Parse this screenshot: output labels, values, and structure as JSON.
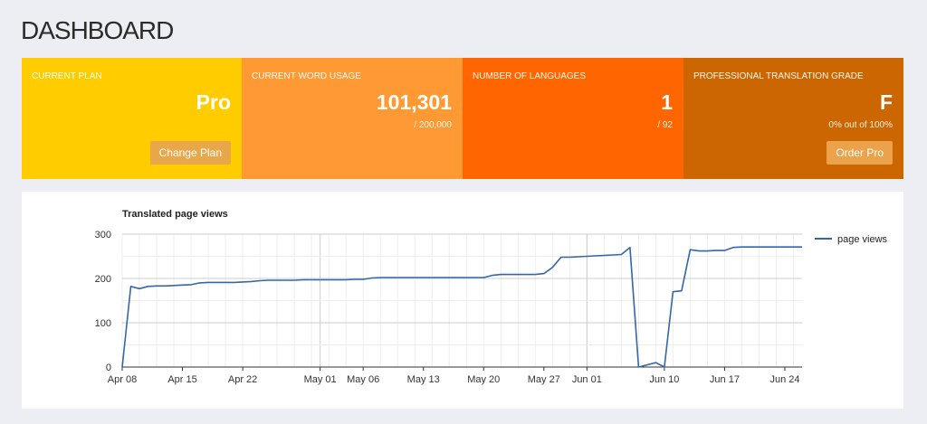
{
  "header": {
    "title": "DASHBOARD"
  },
  "cards": [
    {
      "label": "CURRENT PLAN",
      "value": "Pro",
      "sub": "",
      "button": "Change Plan",
      "bg": "#ffcc00",
      "btn_bg": "#e8a84a"
    },
    {
      "label": "CURRENT WORD USAGE",
      "value": "101,301",
      "sub": "/ 200,000",
      "button": "",
      "bg": "#ff9933",
      "btn_bg": ""
    },
    {
      "label": "NUMBER OF LANGUAGES",
      "value": "1",
      "sub": "/ 92",
      "button": "",
      "bg": "#ff6600",
      "btn_bg": ""
    },
    {
      "label": "PROFESSIONAL TRANSLATION GRADE",
      "value": "F",
      "sub": "0% out of 100%",
      "button": "Order Pro",
      "bg": "#cc6600",
      "btn_bg": "#eba24a"
    }
  ],
  "chart_data": {
    "type": "line",
    "title": "Translated page views",
    "xlabel": "",
    "ylabel": "",
    "ylim": [
      0,
      300
    ],
    "yticks": [
      0,
      100,
      200,
      300
    ],
    "xticks": [
      "Apr 08",
      "Apr 15",
      "Apr 22",
      "May 01",
      "May 06",
      "May 13",
      "May 20",
      "May 27",
      "Jun 01",
      "Jun 10",
      "Jun 17",
      "Jun 24"
    ],
    "legend": "right",
    "grid": true,
    "series": [
      {
        "name": "page views",
        "color": "#3366aa",
        "x": [
          "Apr 08",
          "Apr 09",
          "Apr 10",
          "Apr 11",
          "Apr 12",
          "Apr 13",
          "Apr 14",
          "Apr 15",
          "Apr 16",
          "Apr 17",
          "Apr 18",
          "Apr 19",
          "Apr 20",
          "Apr 21",
          "Apr 22",
          "Apr 23",
          "Apr 24",
          "Apr 25",
          "Apr 26",
          "Apr 27",
          "Apr 28",
          "Apr 29",
          "Apr 30",
          "May 01",
          "May 02",
          "May 03",
          "May 04",
          "May 05",
          "May 06",
          "May 07",
          "May 08",
          "May 09",
          "May 10",
          "May 11",
          "May 12",
          "May 13",
          "May 14",
          "May 15",
          "May 16",
          "May 17",
          "May 18",
          "May 19",
          "May 20",
          "May 21",
          "May 22",
          "May 23",
          "May 24",
          "May 25",
          "May 26",
          "May 27",
          "May 28",
          "May 29",
          "May 30",
          "May 31",
          "Jun 01",
          "Jun 02",
          "Jun 03",
          "Jun 04",
          "Jun 05",
          "Jun 06",
          "Jun 07",
          "Jun 08",
          "Jun 09",
          "Jun 10",
          "Jun 11",
          "Jun 12",
          "Jun 13",
          "Jun 14",
          "Jun 15",
          "Jun 16",
          "Jun 17",
          "Jun 18",
          "Jun 19",
          "Jun 20",
          "Jun 21",
          "Jun 22",
          "Jun 23",
          "Jun 24",
          "Jun 25",
          "Jun 26"
        ],
        "values": [
          0,
          182,
          177,
          182,
          183,
          183,
          184,
          185,
          186,
          190,
          191,
          191,
          191,
          191,
          192,
          193,
          195,
          196,
          196,
          196,
          196,
          197,
          197,
          197,
          197,
          197,
          197,
          198,
          198,
          201,
          202,
          202,
          202,
          202,
          202,
          202,
          202,
          202,
          202,
          202,
          202,
          202,
          202,
          207,
          209,
          209,
          209,
          209,
          209,
          211,
          225,
          248,
          248,
          249,
          250,
          251,
          252,
          253,
          254,
          270,
          0,
          5,
          10,
          0,
          170,
          172,
          265,
          262,
          262,
          263,
          263,
          270,
          271,
          271,
          271,
          271,
          271,
          271,
          271,
          271
        ]
      }
    ]
  }
}
